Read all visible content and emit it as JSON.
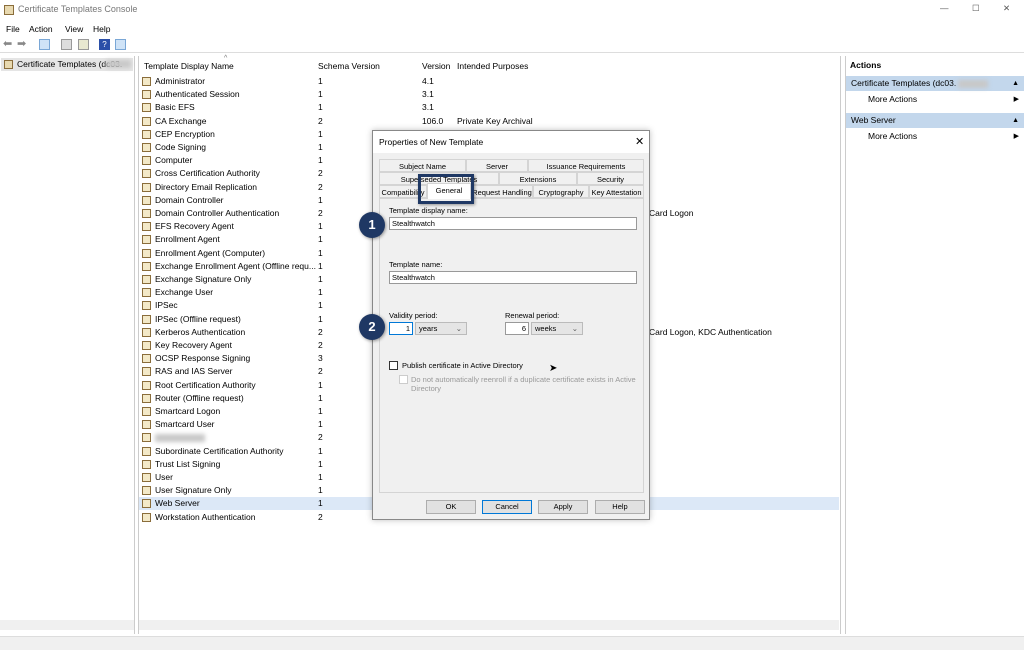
{
  "window": {
    "title": "Certificate Templates Console",
    "controls": [
      "—",
      "☐",
      "✕"
    ]
  },
  "menu": [
    "File",
    "Action",
    "View",
    "Help"
  ],
  "tree": {
    "root": "Certificate Templates (dc03."
  },
  "list": {
    "headers": [
      "Template Display Name",
      "Schema Version",
      "Version",
      "Intended Purposes"
    ],
    "rows": [
      {
        "name": "Administrator",
        "schema": "1",
        "version": "4.1",
        "purpose": ""
      },
      {
        "name": "Authenticated Session",
        "schema": "1",
        "version": "3.1",
        "purpose": ""
      },
      {
        "name": "Basic EFS",
        "schema": "1",
        "version": "3.1",
        "purpose": ""
      },
      {
        "name": "CA Exchange",
        "schema": "2",
        "version": "106.0",
        "purpose": "Private Key Archival"
      },
      {
        "name": "CEP Encryption",
        "schema": "1"
      },
      {
        "name": "Code Signing",
        "schema": "1"
      },
      {
        "name": "Computer",
        "schema": "1"
      },
      {
        "name": "Cross Certification Authority",
        "schema": "2"
      },
      {
        "name": "Directory Email Replication",
        "schema": "2"
      },
      {
        "name": "Domain Controller",
        "schema": "1"
      },
      {
        "name": "Domain Controller Authentication",
        "schema": "2",
        "purpose_tail": "Card Logon"
      },
      {
        "name": "EFS Recovery Agent",
        "schema": "1"
      },
      {
        "name": "Enrollment Agent",
        "schema": "1"
      },
      {
        "name": "Enrollment Agent (Computer)",
        "schema": "1"
      },
      {
        "name": "Exchange Enrollment Agent (Offline requ...",
        "schema": "1"
      },
      {
        "name": "Exchange Signature Only",
        "schema": "1"
      },
      {
        "name": "Exchange User",
        "schema": "1"
      },
      {
        "name": "IPSec",
        "schema": "1"
      },
      {
        "name": "IPSec (Offline request)",
        "schema": "1"
      },
      {
        "name": "Kerberos Authentication",
        "schema": "2",
        "purpose_tail": "Card Logon, KDC Authentication"
      },
      {
        "name": "Key Recovery Agent",
        "schema": "2"
      },
      {
        "name": "OCSP Response Signing",
        "schema": "3"
      },
      {
        "name": "RAS and IAS Server",
        "schema": "2"
      },
      {
        "name": "Root Certification Authority",
        "schema": "1"
      },
      {
        "name": "Router (Offline request)",
        "schema": "1"
      },
      {
        "name": "Smartcard Logon",
        "schema": "1"
      },
      {
        "name": "Smartcard User",
        "schema": "1"
      },
      {
        "name": "",
        "schema": "2",
        "blurred": true
      },
      {
        "name": "Subordinate Certification Authority",
        "schema": "1"
      },
      {
        "name": "Trust List Signing",
        "schema": "1"
      },
      {
        "name": "User",
        "schema": "1"
      },
      {
        "name": "User Signature Only",
        "schema": "1"
      },
      {
        "name": "Web Server",
        "schema": "1",
        "selected": true
      },
      {
        "name": "Workstation Authentication",
        "schema": "2"
      }
    ]
  },
  "actions": {
    "title": "Actions",
    "groups": [
      {
        "header": "Certificate Templates (dc03.",
        "item": "More Actions"
      },
      {
        "header": "Web Server",
        "item": "More Actions"
      }
    ]
  },
  "dialog": {
    "title": "Properties of New Template",
    "tabs_row1": [
      "Subject Name",
      "Server",
      "Issuance Requirements"
    ],
    "tabs_row2": [
      "Superseded Templates",
      "Extensions",
      "Security"
    ],
    "tabs_row3": [
      "Compatibility",
      "General",
      "Request Handling",
      "Cryptography",
      "Key Attestation"
    ],
    "active_tab": "General",
    "display_name_label": "Template display name:",
    "display_name": "Stealthwatch",
    "name_label": "Template name:",
    "name": "Stealthwatch",
    "validity_label": "Validity period:",
    "validity_value": "1",
    "validity_unit": "years",
    "renewal_label": "Renewal period:",
    "renewal_value": "6",
    "renewal_unit": "weeks",
    "publish_label": "Publish certificate in Active Directory",
    "publish_checked": false,
    "reenroll_label": "Do not automatically reenroll if a duplicate certificate exists in Active Directory",
    "buttons": [
      "OK",
      "Cancel",
      "Apply",
      "Help"
    ]
  },
  "annotations": {
    "badge1": "1",
    "badge2": "2",
    "highlight_color": "#1f3864"
  }
}
